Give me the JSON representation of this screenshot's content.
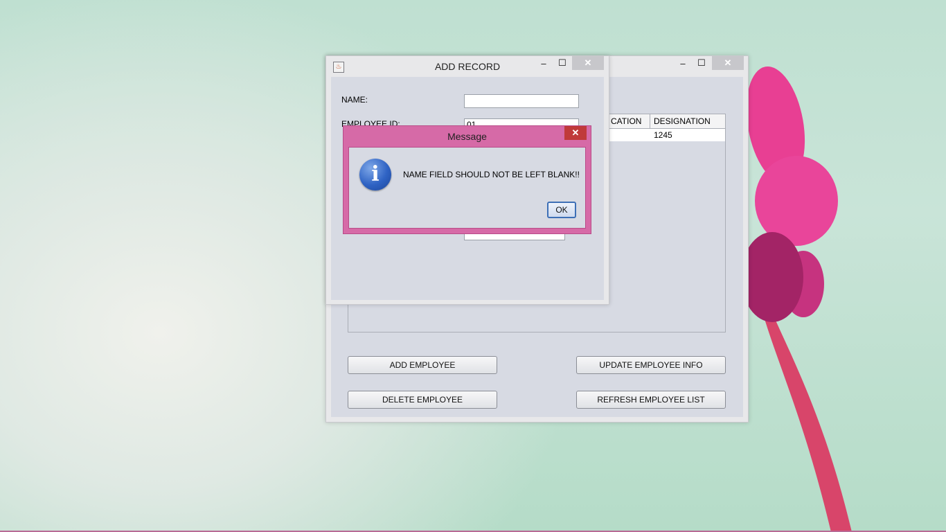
{
  "main_window": {
    "table": {
      "columns": [
        "CATION",
        "DESIGNATION"
      ],
      "rows": [
        [
          "",
          "1245"
        ]
      ]
    },
    "buttons": {
      "add": "ADD EMPLOYEE",
      "update": "UPDATE EMPLOYEE INFO",
      "delete": "DELETE EMPLOYEE",
      "refresh": "REFRESH EMPLOYEE LIST"
    }
  },
  "add_record": {
    "title": "ADD RECORD",
    "fields": {
      "name_label": "NAME:",
      "name_value": "",
      "employee_id_label": "EMPLOYEE ID:",
      "employee_id_value": "01"
    }
  },
  "message": {
    "title": "Message",
    "text": "NAME FIELD SHOULD NOT BE LEFT BLANK!!",
    "ok_label": "OK",
    "icon": "info-icon"
  },
  "window_controls": {
    "minimize": "–",
    "maximize": "☐",
    "close": "✕"
  },
  "colors": {
    "dialog_border": "#d66aa7",
    "close_button": "#c03a3a"
  }
}
